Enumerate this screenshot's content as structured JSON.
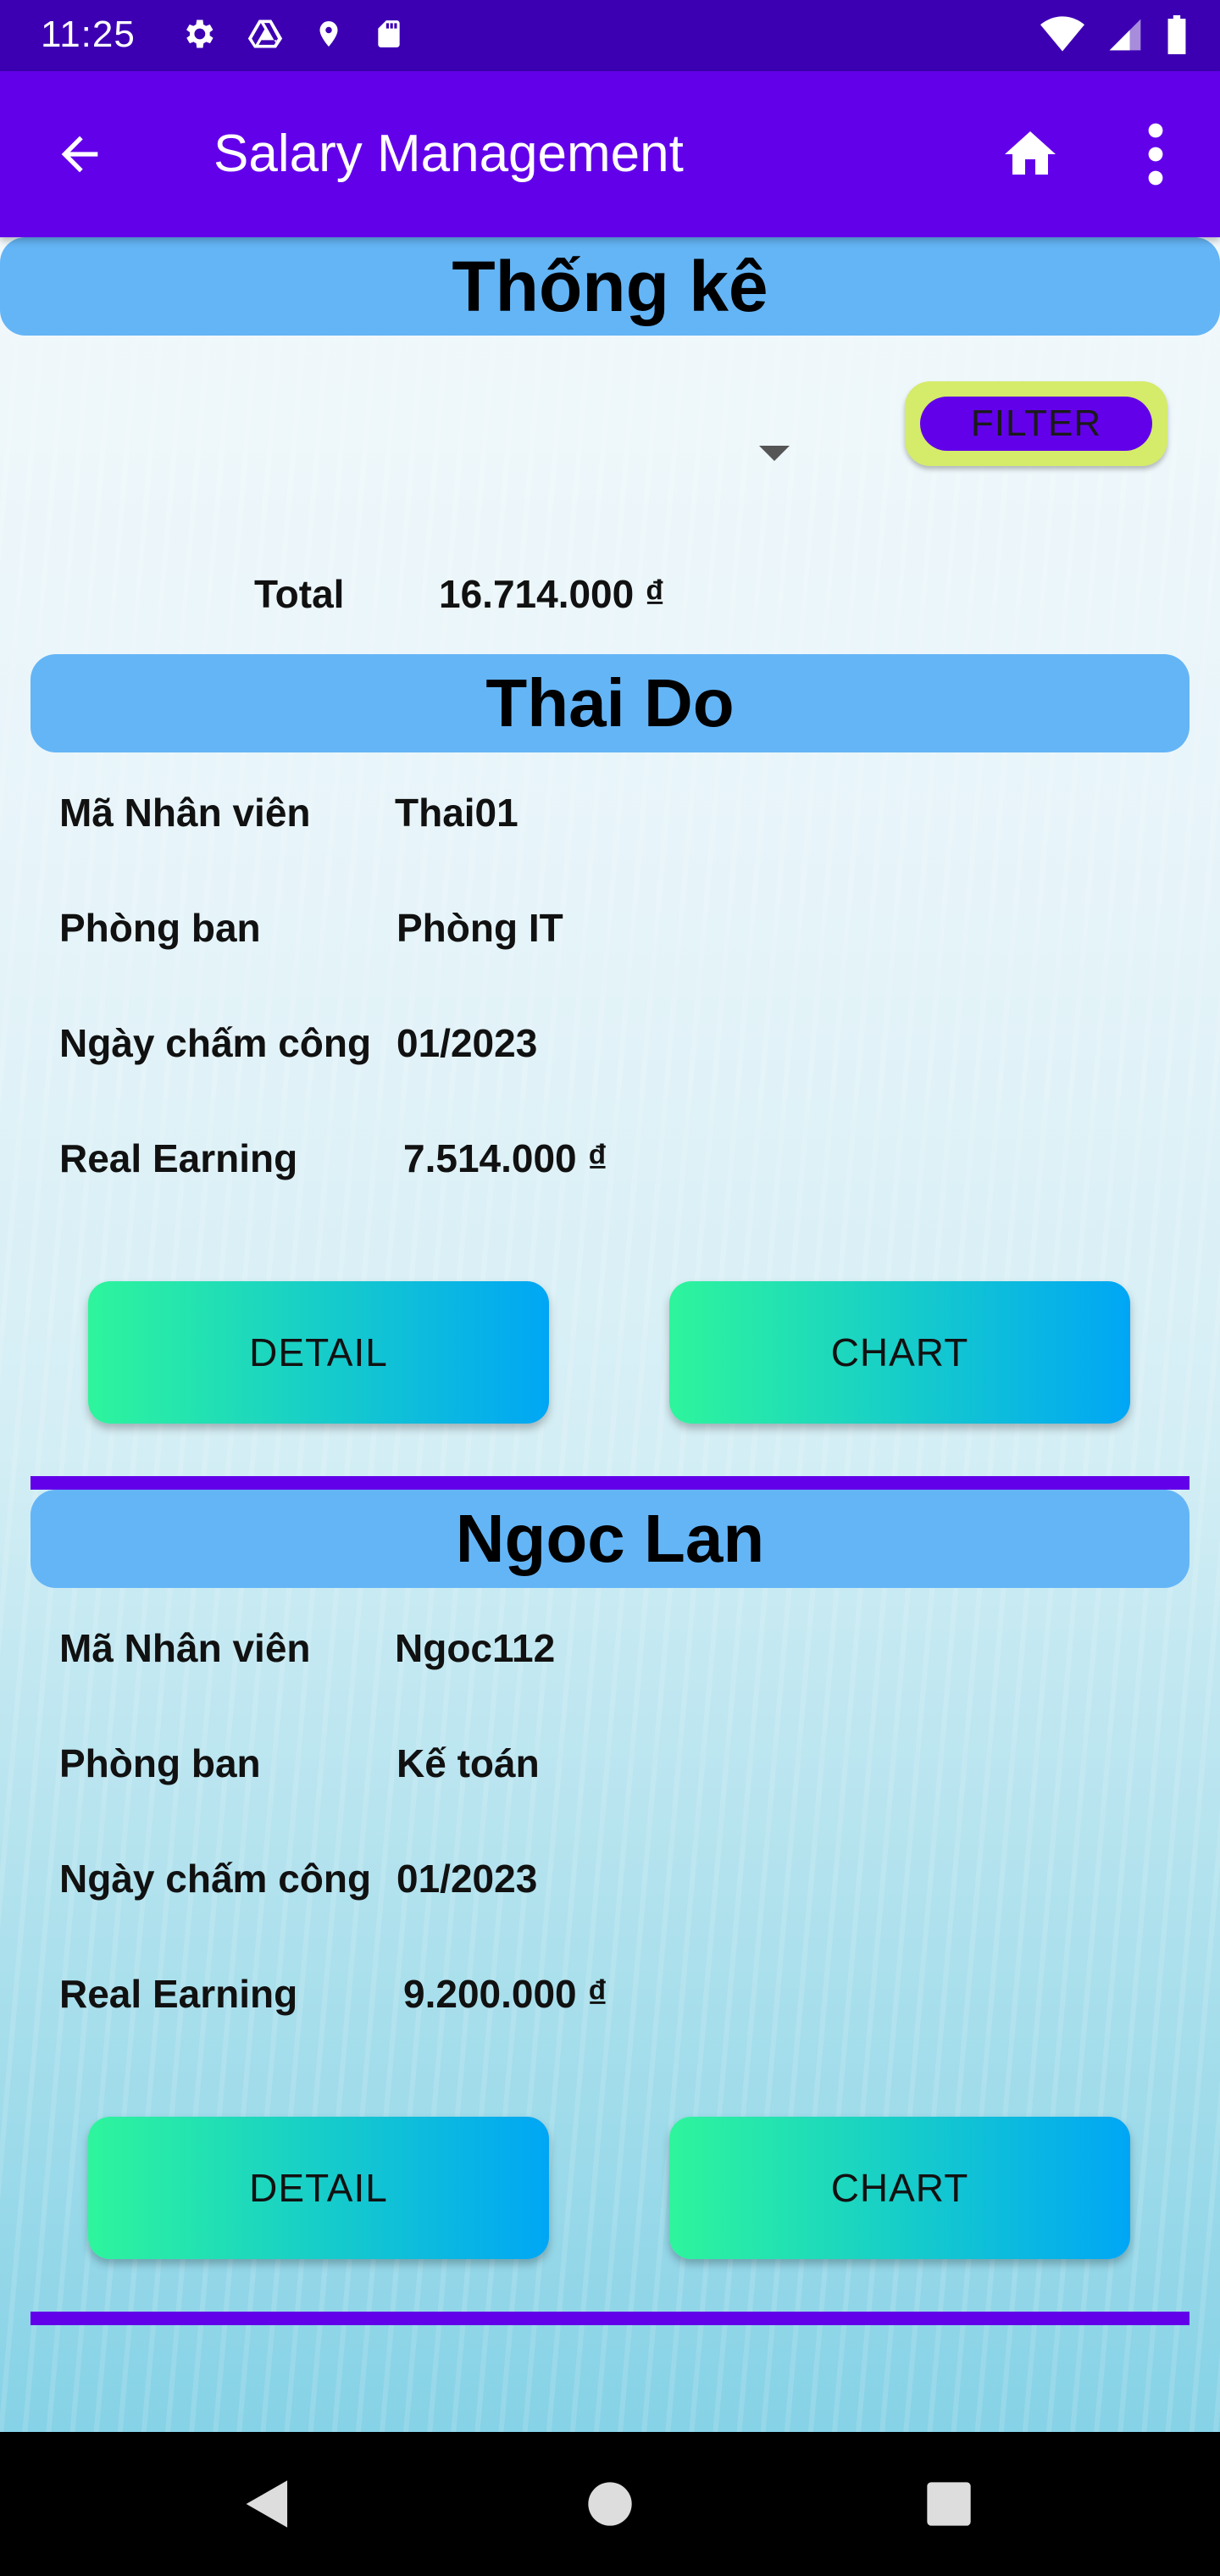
{
  "status_bar": {
    "time": "11:25",
    "icons": [
      "settings-icon",
      "drive-icon",
      "location-icon",
      "sd-card-icon",
      "wifi-icon",
      "signal-icon",
      "battery-icon"
    ]
  },
  "app_bar": {
    "title": "Salary Management",
    "icons": [
      "back-arrow-icon",
      "home-icon",
      "more-vert-icon"
    ]
  },
  "statistics": {
    "title": "Thống kê",
    "filter_label": "FILTER",
    "total_label": "Total",
    "total_value": "16.714.000 ₫"
  },
  "employees": [
    {
      "name": "Thai Do",
      "id_label": "Mã Nhân viên",
      "id_value": "Thai01",
      "dept_label": "Phòng ban",
      "dept_value": "Phòng IT",
      "date_label": "Ngày chấm công",
      "date_value": "01/2023",
      "earning_label": "Real Earning",
      "earning_value": "7.514.000 ₫",
      "detail_label": "DETAIL",
      "chart_label": "CHART"
    },
    {
      "name": "Ngoc Lan",
      "id_label": "Mã Nhân viên",
      "id_value": "Ngoc112",
      "dept_label": "Phòng ban",
      "dept_value": "Kế toán",
      "date_label": "Ngày chấm công",
      "date_value": "01/2023",
      "earning_label": "Real Earning",
      "earning_value": "9.200.000 ₫",
      "detail_label": "DETAIL",
      "chart_label": "CHART"
    }
  ],
  "colors": {
    "status_bar": "#3c00b2",
    "app_bar": "#6200ea",
    "title_pill": "#64b5f6",
    "filter_outer": "#d5eb6a",
    "divider": "#6200ea",
    "button_gradient_start": "#2ef59c",
    "button_gradient_end": "#00a6f5"
  },
  "nav_bar": {
    "icons": [
      "nav-back-icon",
      "nav-home-icon",
      "nav-recents-icon"
    ]
  }
}
